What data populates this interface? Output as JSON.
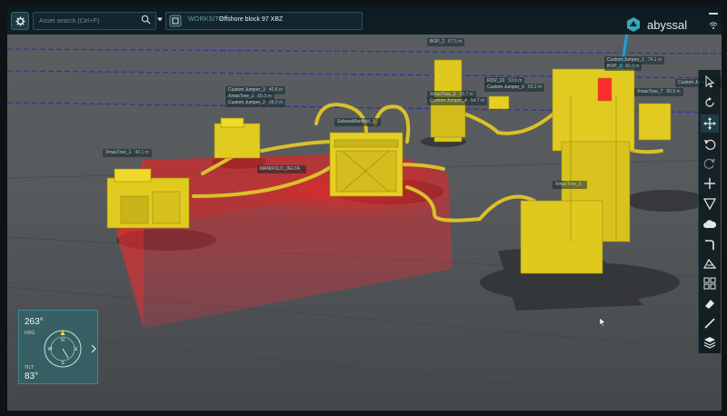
{
  "topbar": {
    "search_placeholder": "Asset search (Ctrl+F)",
    "worksite_tag": "WORKSITE",
    "worksite_name": "Offshore block 97 XBZ"
  },
  "brand": {
    "name": "abyssal"
  },
  "compass": {
    "heading": "263°",
    "heading_label": "HDG",
    "tilt": "83°",
    "tilt_label": "TILT",
    "north": "N",
    "west": "W",
    "east": "E",
    "south": "S"
  },
  "labels": [
    {
      "name": "Custom Jumper_3",
      "value": "40.8 m"
    },
    {
      "name": "XmasTree_1",
      "value": "55.3 m"
    },
    {
      "name": "Custom Jumper_2",
      "value": "38.3 m"
    },
    {
      "name": "XmasTree_1",
      "value": "40.1 m"
    },
    {
      "name": "BOP_2",
      "value": "67.5 m"
    },
    {
      "name": "XmasTree_3",
      "value": "66.7 m"
    },
    {
      "name": "Custom Jumper_4",
      "value": "54.7 m"
    },
    {
      "name": "ROV_13",
      "value": "53.5 m"
    },
    {
      "name": "Custom Jumper_5",
      "value": "69.2 m"
    },
    {
      "name": "Custom Jumper_1",
      "value": "74.1 m"
    },
    {
      "name": "BOP_3",
      "value": "80.3 m"
    },
    {
      "name": "XmasTree_7",
      "value": "88.5 m"
    },
    {
      "name": "Custom Jumper_6",
      "value": ""
    },
    {
      "name": "MANIFOLD_DELTA",
      "value": ""
    },
    {
      "name": "SubseaManifold_1",
      "value": ""
    },
    {
      "name": "XmasTree_3",
      "value": ""
    }
  ],
  "colors": {
    "accent": "#3aa6b9",
    "equipment": "#e9d21f",
    "zone": "#e8202a"
  }
}
